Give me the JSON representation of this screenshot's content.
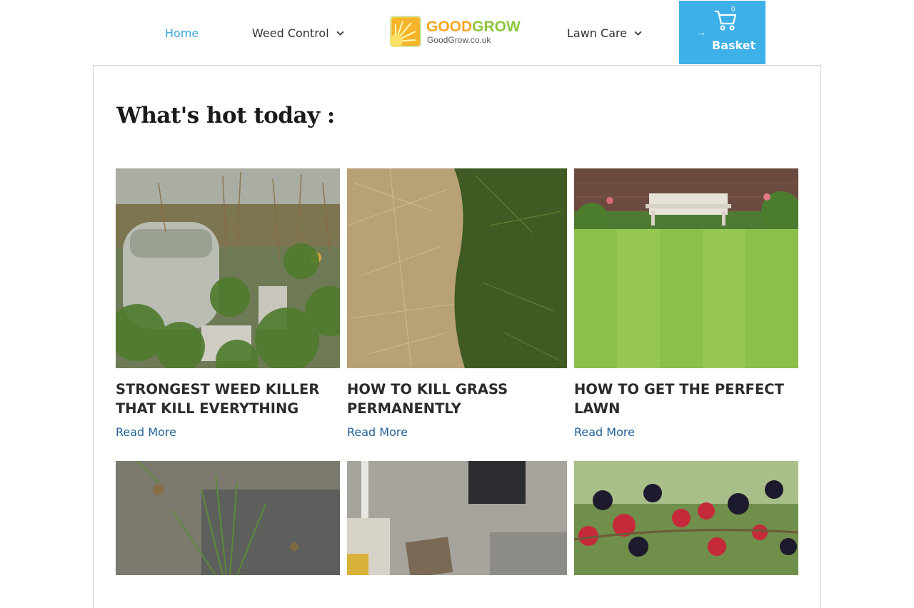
{
  "nav": {
    "home": "Home",
    "weed_control": "Weed Control",
    "lawn_care": "Lawn Care",
    "basket": "Basket",
    "basket_count": "0"
  },
  "logo": {
    "name_part1": "GOOD",
    "name_part2": "GROW",
    "domain": "GoodGrow.co.uk"
  },
  "main": {
    "heading": "What's hot today :",
    "articles": [
      {
        "title": "STRONGEST WEED KILLER THAT KILL EVERYTHING",
        "read_more": "Read More"
      },
      {
        "title": "HOW TO KILL GRASS PERMANENTLY",
        "read_more": "Read More"
      },
      {
        "title": "HOW TO GET THE PERFECT LAWN",
        "read_more": "Read More"
      }
    ]
  },
  "colors": {
    "accent": "#3db0e8",
    "active_nav": "#3aa6d8",
    "link": "#1f5f97"
  }
}
